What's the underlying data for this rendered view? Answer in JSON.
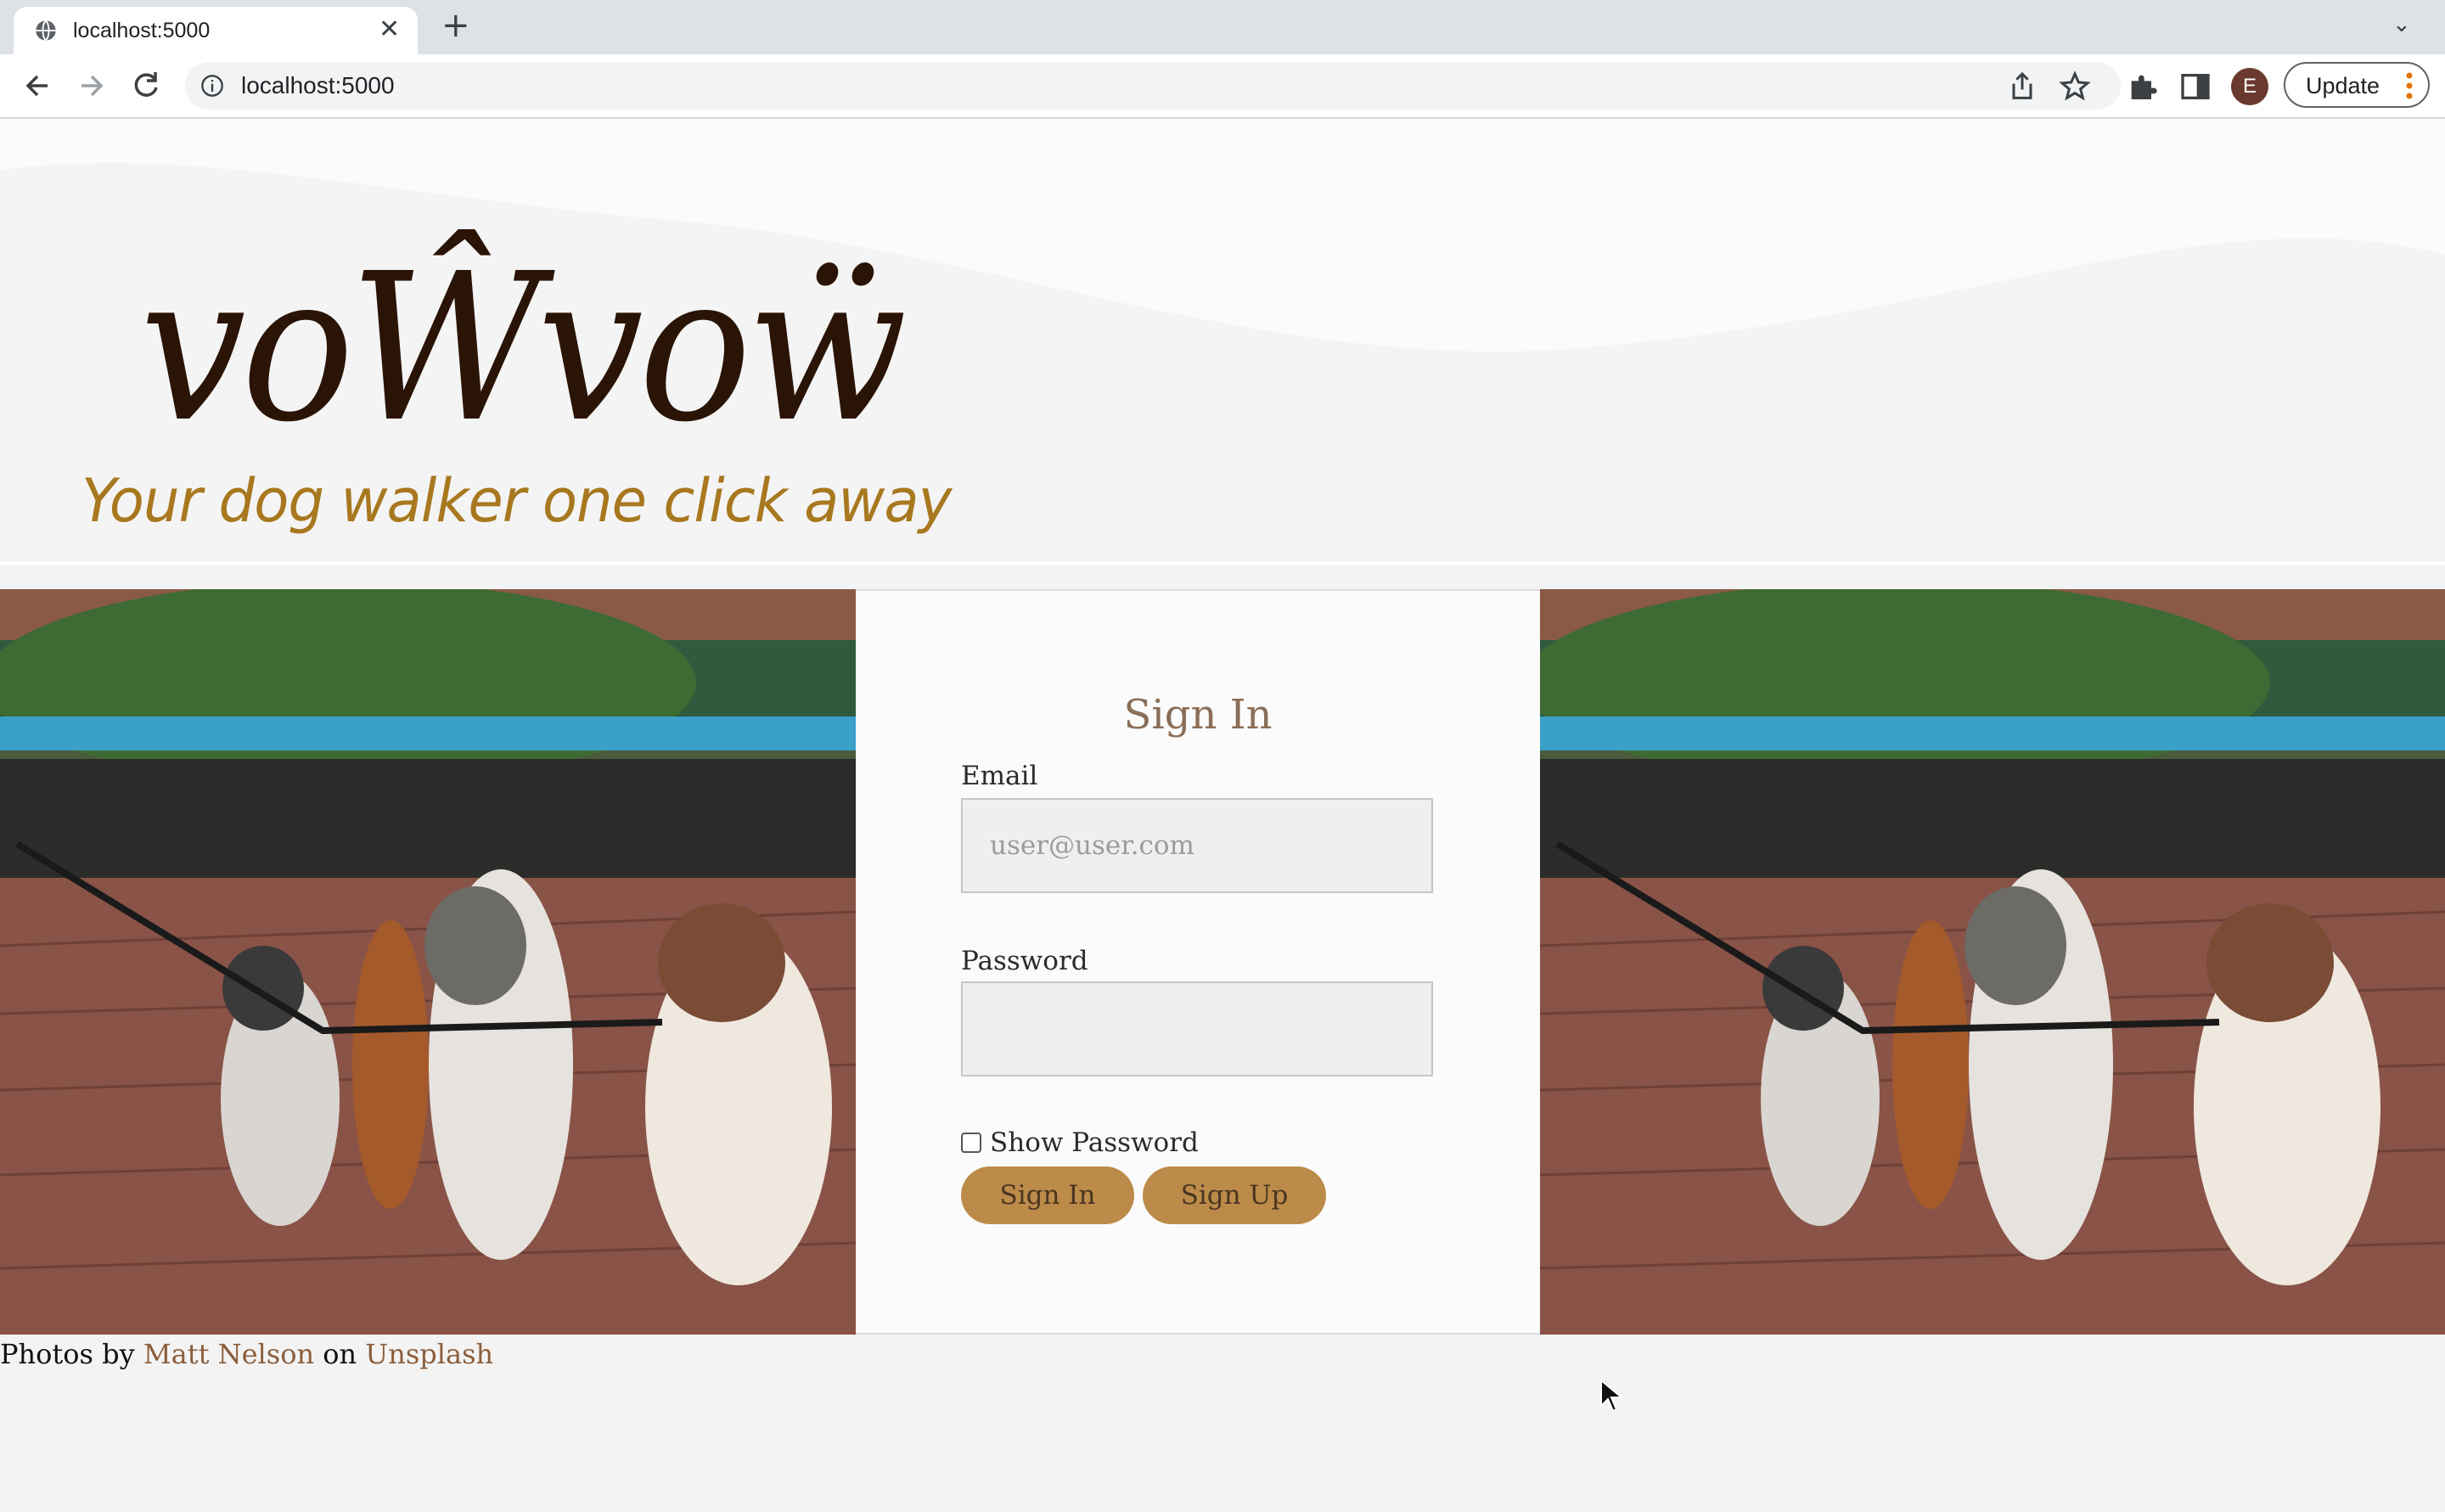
{
  "browser": {
    "tab_title": "localhost:5000",
    "url": "localhost:5000",
    "profile_initial": "E",
    "update_label": "Update",
    "icons": {
      "favicon": "globe-icon",
      "tab_close": "close-icon",
      "new_tab": "plus-icon",
      "tab_list": "chevron-down-icon",
      "back": "arrow-left-icon",
      "forward": "arrow-right-icon",
      "reload": "reload-icon",
      "site_info": "info-icon",
      "share": "share-icon",
      "bookmark": "star-icon",
      "extensions": "puzzle-icon",
      "side_panel": "side-panel-icon",
      "menu": "kebab-menu-icon"
    }
  },
  "header": {
    "logo": "voŴvoẅ",
    "tagline": "Your dog walker one click away"
  },
  "signin": {
    "title": "Sign In",
    "email_label": "Email",
    "email_placeholder": "user@user.com",
    "email_value": "",
    "password_label": "Password",
    "password_value": "",
    "show_password_label": "Show Password",
    "show_password_checked": false,
    "signin_button": "Sign In",
    "signup_button": "Sign Up"
  },
  "credits": {
    "prefix": "Photos by",
    "author": "Matt Nelson",
    "middle": "on",
    "site": "Unsplash"
  },
  "colors": {
    "logo": "#2a1406",
    "tagline": "#a8781f",
    "button": "#bc8b49",
    "title": "#8a6e57",
    "link": "#8b5e3c"
  }
}
